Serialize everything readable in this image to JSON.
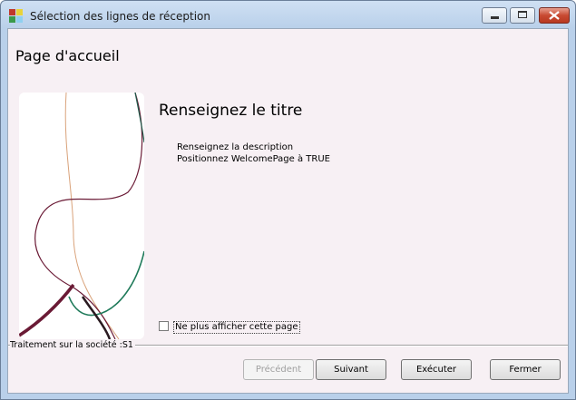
{
  "window": {
    "title": "Sélection des lignes de réception",
    "icon": "app-icon",
    "controls": {
      "minimize": "minimize-icon",
      "maximize": "maximize-icon",
      "close": "close-icon"
    }
  },
  "wizard": {
    "page_title": "Page d'accueil",
    "heading": "Renseignez le titre",
    "description_lines": [
      "Renseignez la description",
      "Positionnez WelcomePage à TRUE"
    ],
    "checkbox_label": "Ne plus afficher cette page",
    "checkbox_checked": false
  },
  "status": {
    "text": "Traitement sur la société :S1"
  },
  "buttons": {
    "previous": "Précédent",
    "next": "Suivant",
    "execute": "Exécuter",
    "close": "Fermer"
  },
  "colors": {
    "accent_green": "#1f7a5a",
    "accent_maroon": "#6a1a35",
    "accent_tan": "#d9a27a",
    "close_red": "#c84a32"
  }
}
